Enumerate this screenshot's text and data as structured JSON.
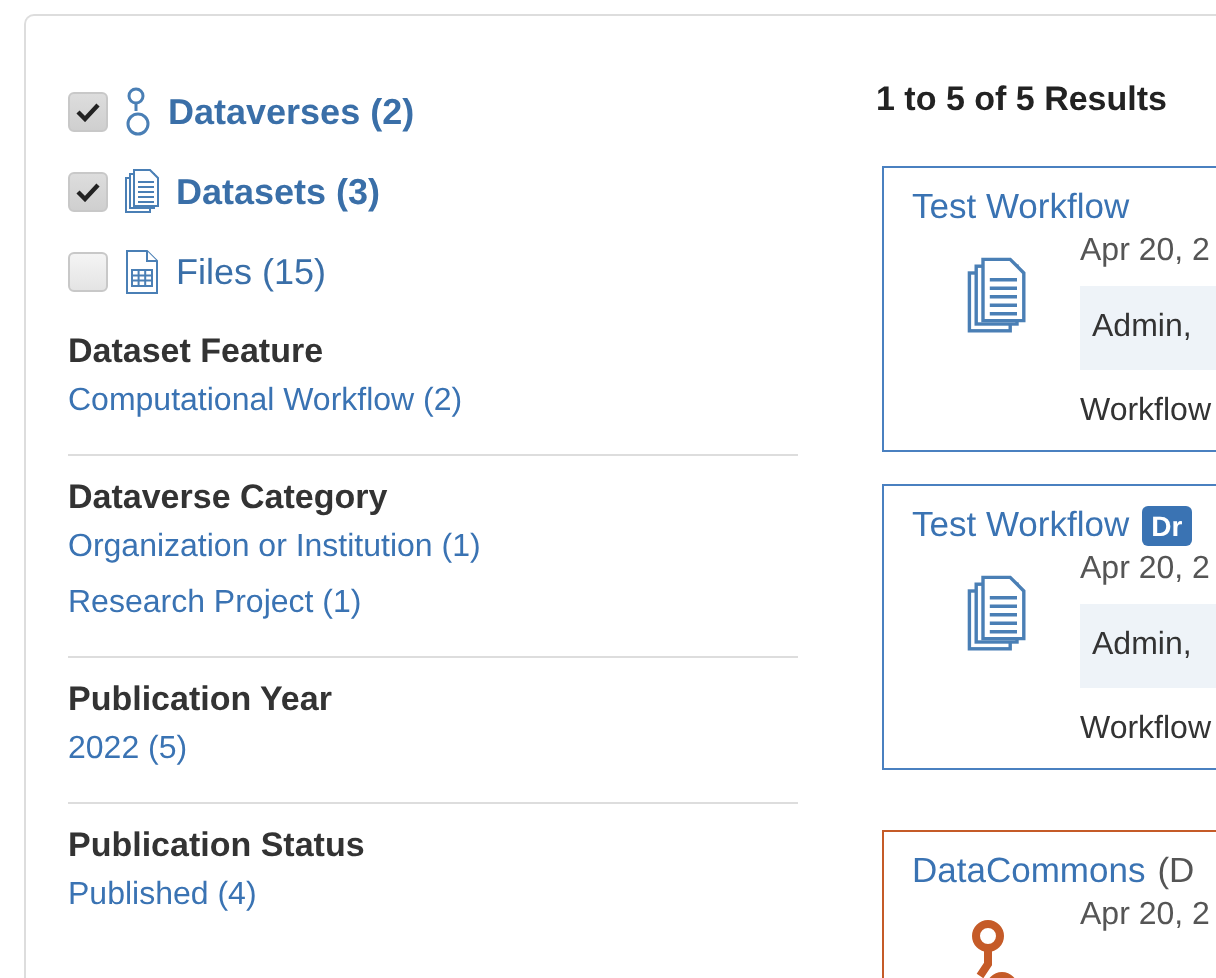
{
  "type_filters": [
    {
      "kind": "dataverse",
      "label": "Dataverses (2)",
      "checked": true
    },
    {
      "kind": "dataset",
      "label": "Datasets (3)",
      "checked": true
    },
    {
      "kind": "file",
      "label": "Files (15)",
      "checked": false
    }
  ],
  "facets": [
    {
      "title": "Dataset Feature",
      "items": [
        "Computational Workflow (2)"
      ]
    },
    {
      "title": "Dataverse Category",
      "items": [
        "Organization or Institution (1)",
        "Research Project (1)"
      ]
    },
    {
      "title": "Publication Year",
      "items": [
        "2022 (5)"
      ]
    },
    {
      "title": "Publication Status",
      "items": [
        "Published (4)"
      ]
    }
  ],
  "results": {
    "summary": "1 to 5 of 5 Results",
    "cards": [
      {
        "kind": "dataset",
        "title": "Test Workflow",
        "date": "Apr 20, 2",
        "author": "Admin,",
        "description": "Workflow"
      },
      {
        "kind": "dataset",
        "title": "Test Workflow",
        "badge": "Dr",
        "date": "Apr 20, 2",
        "author": "Admin,",
        "description": "Workflow"
      },
      {
        "kind": "dataverse",
        "title": "DataCommons",
        "subtitle": "(D",
        "date": "Apr 20, 2"
      }
    ]
  }
}
